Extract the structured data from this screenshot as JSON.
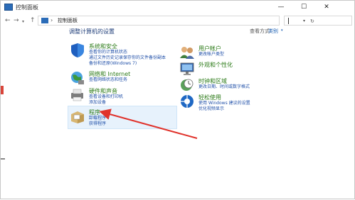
{
  "window": {
    "title": "控制面板",
    "minimize": "—",
    "maximize": "☐",
    "close": "✕"
  },
  "nav": {
    "back": "←",
    "forward": "→",
    "dropdown": "▾",
    "up": "↑",
    "address_separator": "›",
    "address_text": "控制面板",
    "address_dropdown": "▾",
    "refresh": "↻",
    "search_placeholder": ""
  },
  "main": {
    "heading": "调整计算机的设置",
    "view_by_label": "查看方式:",
    "view_by_value": "类别",
    "view_by_arrow": "▾"
  },
  "left_categories": [
    {
      "title": "系统和安全",
      "icon": "shield-icon",
      "links": [
        "查看你的计算机状态",
        "通过文件历史记录保存你的文件备份副本",
        "备份和还原(Windows 7)"
      ]
    },
    {
      "title": "网络和 Internet",
      "icon": "globe-network-icon",
      "links": [
        "查看网络状态和任务"
      ]
    },
    {
      "title": "硬件和声音",
      "icon": "printer-icon",
      "links": [
        "查看设备和打印机",
        "添加设备"
      ]
    },
    {
      "title": "程序",
      "icon": "programs-box-icon",
      "links": [
        "卸载程序",
        "获得程序"
      ]
    }
  ],
  "right_categories": [
    {
      "title": "用户帐户",
      "icon": "users-icon",
      "links": [
        "更改帐户类型"
      ]
    },
    {
      "title": "外观和个性化",
      "icon": "monitor-icon",
      "links": []
    },
    {
      "title": "时钟和区域",
      "icon": "clock-globe-icon",
      "links": [
        "更改日期、时间或数字格式"
      ]
    },
    {
      "title": "轻松使用",
      "icon": "ease-of-access-icon",
      "links": [
        "使用 Windows 建议的设置",
        "优化视频显示"
      ]
    }
  ],
  "colors": {
    "category_title": "#2b7a17",
    "link": "#1f4fa8",
    "heading": "#1e3c78",
    "highlight_bg": "#e7f2fc",
    "annotation_arrow": "#e0322b"
  }
}
